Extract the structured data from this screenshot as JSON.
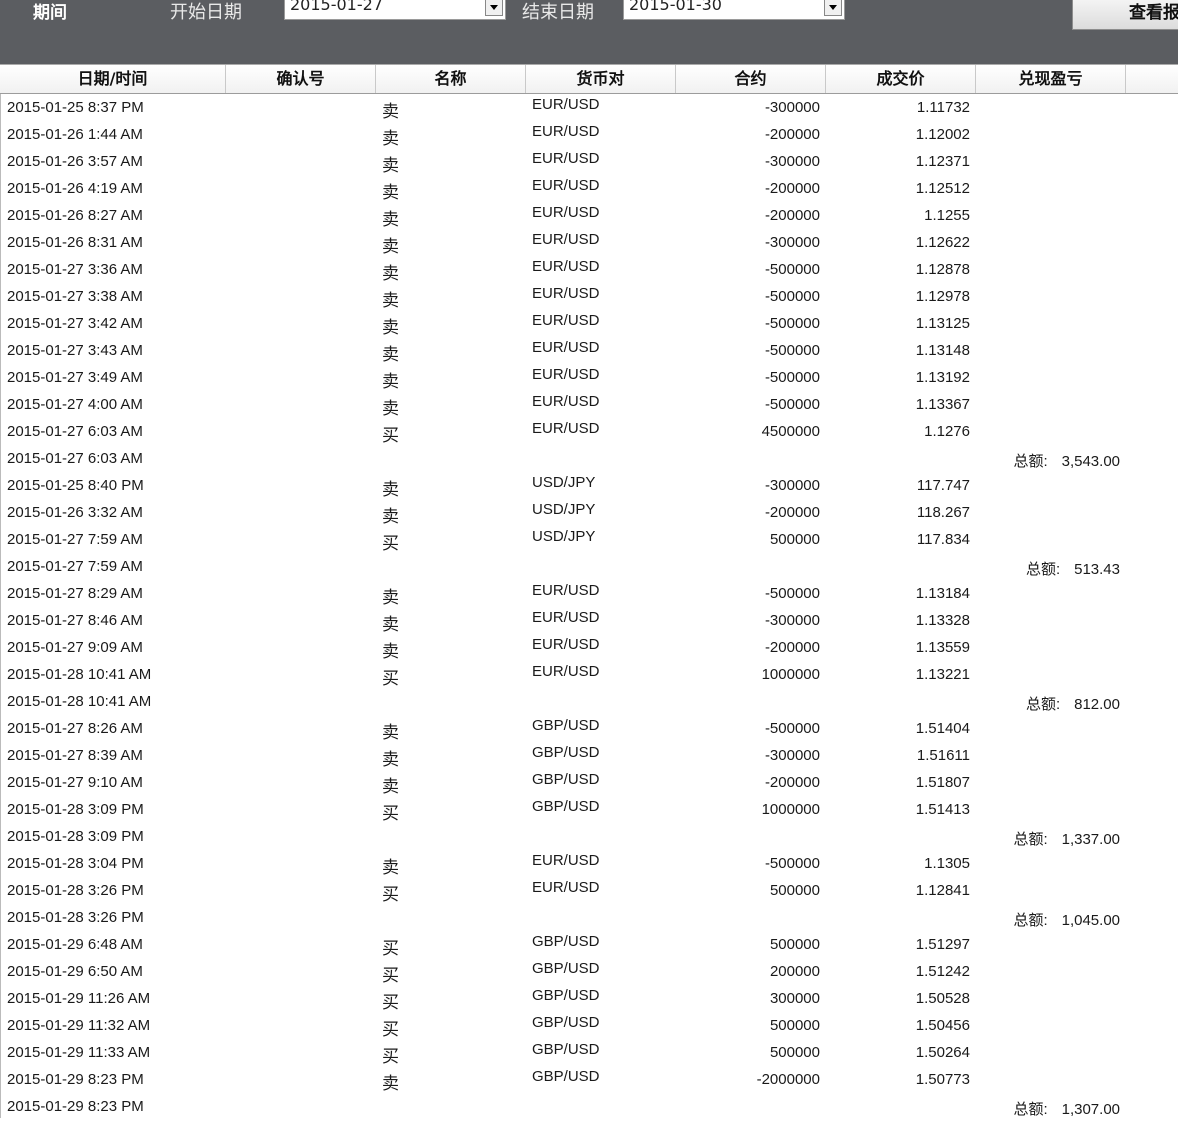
{
  "filter": {
    "period_label": "期间",
    "start_label": "开始日期",
    "start_value": "2015-01-27",
    "end_label": "结束日期",
    "end_value": "2015-01-30",
    "view_button": "查看报"
  },
  "columns": [
    "日期/时间",
    "确认号",
    "名称",
    "货币对",
    "合约",
    "成交价",
    "兑现盈亏"
  ],
  "total_label": "总额:",
  "rows": [
    {
      "dt": "2015-01-25 8:37 PM",
      "name": "卖",
      "pair": "EUR/USD",
      "contract": "-300000",
      "price": "1.11732",
      "total": ""
    },
    {
      "dt": "2015-01-26 1:44 AM",
      "name": "卖",
      "pair": "EUR/USD",
      "contract": "-200000",
      "price": "1.12002",
      "total": ""
    },
    {
      "dt": "2015-01-26 3:57 AM",
      "name": "卖",
      "pair": "EUR/USD",
      "contract": "-300000",
      "price": "1.12371",
      "total": ""
    },
    {
      "dt": "2015-01-26 4:19 AM",
      "name": "卖",
      "pair": "EUR/USD",
      "contract": "-200000",
      "price": "1.12512",
      "total": ""
    },
    {
      "dt": "2015-01-26 8:27 AM",
      "name": "卖",
      "pair": "EUR/USD",
      "contract": "-200000",
      "price": "1.1255",
      "total": ""
    },
    {
      "dt": "2015-01-26 8:31 AM",
      "name": "卖",
      "pair": "EUR/USD",
      "contract": "-300000",
      "price": "1.12622",
      "total": ""
    },
    {
      "dt": "2015-01-27 3:36 AM",
      "name": "卖",
      "pair": "EUR/USD",
      "contract": "-500000",
      "price": "1.12878",
      "total": ""
    },
    {
      "dt": "2015-01-27 3:38 AM",
      "name": "卖",
      "pair": "EUR/USD",
      "contract": "-500000",
      "price": "1.12978",
      "total": ""
    },
    {
      "dt": "2015-01-27 3:42 AM",
      "name": "卖",
      "pair": "EUR/USD",
      "contract": "-500000",
      "price": "1.13125",
      "total": ""
    },
    {
      "dt": "2015-01-27 3:43 AM",
      "name": "卖",
      "pair": "EUR/USD",
      "contract": "-500000",
      "price": "1.13148",
      "total": ""
    },
    {
      "dt": "2015-01-27 3:49 AM",
      "name": "卖",
      "pair": "EUR/USD",
      "contract": "-500000",
      "price": "1.13192",
      "total": ""
    },
    {
      "dt": "2015-01-27 4:00 AM",
      "name": "卖",
      "pair": "EUR/USD",
      "contract": "-500000",
      "price": "1.13367",
      "total": ""
    },
    {
      "dt": "2015-01-27 6:03 AM",
      "name": "买",
      "pair": "EUR/USD",
      "contract": "4500000",
      "price": "1.1276",
      "total": ""
    },
    {
      "dt": "2015-01-27 6:03 AM",
      "name": "",
      "pair": "",
      "contract": "",
      "price": "",
      "total": "3,543.00"
    },
    {
      "dt": "2015-01-25 8:40 PM",
      "name": "卖",
      "pair": "USD/JPY",
      "contract": "-300000",
      "price": "117.747",
      "total": ""
    },
    {
      "dt": "2015-01-26 3:32 AM",
      "name": "卖",
      "pair": "USD/JPY",
      "contract": "-200000",
      "price": "118.267",
      "total": ""
    },
    {
      "dt": "2015-01-27 7:59 AM",
      "name": "买",
      "pair": "USD/JPY",
      "contract": "500000",
      "price": "117.834",
      "total": ""
    },
    {
      "dt": "2015-01-27 7:59 AM",
      "name": "",
      "pair": "",
      "contract": "",
      "price": "",
      "total": "513.43"
    },
    {
      "dt": "2015-01-27 8:29 AM",
      "name": "卖",
      "pair": "EUR/USD",
      "contract": "-500000",
      "price": "1.13184",
      "total": ""
    },
    {
      "dt": "2015-01-27 8:46 AM",
      "name": "卖",
      "pair": "EUR/USD",
      "contract": "-300000",
      "price": "1.13328",
      "total": ""
    },
    {
      "dt": "2015-01-27 9:09 AM",
      "name": "卖",
      "pair": "EUR/USD",
      "contract": "-200000",
      "price": "1.13559",
      "total": ""
    },
    {
      "dt": "2015-01-28 10:41 AM",
      "name": "买",
      "pair": "EUR/USD",
      "contract": "1000000",
      "price": "1.13221",
      "total": ""
    },
    {
      "dt": "2015-01-28 10:41 AM",
      "name": "",
      "pair": "",
      "contract": "",
      "price": "",
      "total": "812.00"
    },
    {
      "dt": "2015-01-27 8:26 AM",
      "name": "卖",
      "pair": "GBP/USD",
      "contract": "-500000",
      "price": "1.51404",
      "total": ""
    },
    {
      "dt": "2015-01-27 8:39 AM",
      "name": "卖",
      "pair": "GBP/USD",
      "contract": "-300000",
      "price": "1.51611",
      "total": ""
    },
    {
      "dt": "2015-01-27 9:10 AM",
      "name": "卖",
      "pair": "GBP/USD",
      "contract": "-200000",
      "price": "1.51807",
      "total": ""
    },
    {
      "dt": "2015-01-28 3:09 PM",
      "name": "买",
      "pair": "GBP/USD",
      "contract": "1000000",
      "price": "1.51413",
      "total": ""
    },
    {
      "dt": "2015-01-28 3:09 PM",
      "name": "",
      "pair": "",
      "contract": "",
      "price": "",
      "total": "1,337.00"
    },
    {
      "dt": "2015-01-28 3:04 PM",
      "name": "卖",
      "pair": "EUR/USD",
      "contract": "-500000",
      "price": "1.1305",
      "total": ""
    },
    {
      "dt": "2015-01-28 3:26 PM",
      "name": "买",
      "pair": "EUR/USD",
      "contract": "500000",
      "price": "1.12841",
      "total": ""
    },
    {
      "dt": "2015-01-28 3:26 PM",
      "name": "",
      "pair": "",
      "contract": "",
      "price": "",
      "total": "1,045.00"
    },
    {
      "dt": "2015-01-29 6:48 AM",
      "name": "买",
      "pair": "GBP/USD",
      "contract": "500000",
      "price": "1.51297",
      "total": ""
    },
    {
      "dt": "2015-01-29 6:50 AM",
      "name": "买",
      "pair": "GBP/USD",
      "contract": "200000",
      "price": "1.51242",
      "total": ""
    },
    {
      "dt": "2015-01-29 11:26 AM",
      "name": "买",
      "pair": "GBP/USD",
      "contract": "300000",
      "price": "1.50528",
      "total": ""
    },
    {
      "dt": "2015-01-29 11:32 AM",
      "name": "买",
      "pair": "GBP/USD",
      "contract": "500000",
      "price": "1.50456",
      "total": ""
    },
    {
      "dt": "2015-01-29 11:33 AM",
      "name": "买",
      "pair": "GBP/USD",
      "contract": "500000",
      "price": "1.50264",
      "total": ""
    },
    {
      "dt": "2015-01-29 8:23 PM",
      "name": "卖",
      "pair": "GBP/USD",
      "contract": "-2000000",
      "price": "1.50773",
      "total": ""
    },
    {
      "dt": "2015-01-29 8:23 PM",
      "name": "",
      "pair": "",
      "contract": "",
      "price": "",
      "total": "1,307.00"
    }
  ]
}
